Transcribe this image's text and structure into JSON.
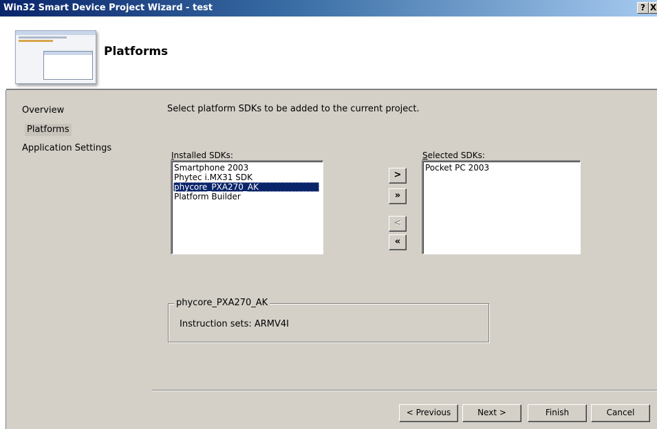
{
  "window": {
    "title": "Win32 Smart Device Project Wizard - test",
    "help_label": "?",
    "close_label": "X"
  },
  "header": {
    "page_title": "Platforms"
  },
  "nav": {
    "items": [
      {
        "label": "Overview",
        "selected": false
      },
      {
        "label": "Platforms",
        "selected": true
      },
      {
        "label": "Application Settings",
        "selected": false
      }
    ]
  },
  "main": {
    "instructions": "Select platform SDKs to be added to the current project.",
    "installed": {
      "label": "Installed SDKs:",
      "items": [
        "Smartphone 2003",
        "Phytec i.MX31 SDK",
        "phycore_PXA270_AK",
        "Platform Builder"
      ],
      "selected_item": "phycore_PXA270_AK"
    },
    "selected": {
      "label": "Selected SDKs:",
      "items": [
        "Pocket PC 2003"
      ]
    },
    "buttons": {
      "add": ">",
      "add_all": "»",
      "remove": "<",
      "remove_all": "«"
    },
    "details": {
      "legend": "phycore_PXA270_AK",
      "text": "Instruction sets:  ARMV4I"
    }
  },
  "footer": {
    "previous": "< Previous",
    "next": "Next >",
    "finish": "Finish",
    "cancel": "Cancel"
  },
  "colors": {
    "selection": "#0a246a",
    "dialog": "#d4d0c8",
    "title_start": "#0a246a"
  }
}
